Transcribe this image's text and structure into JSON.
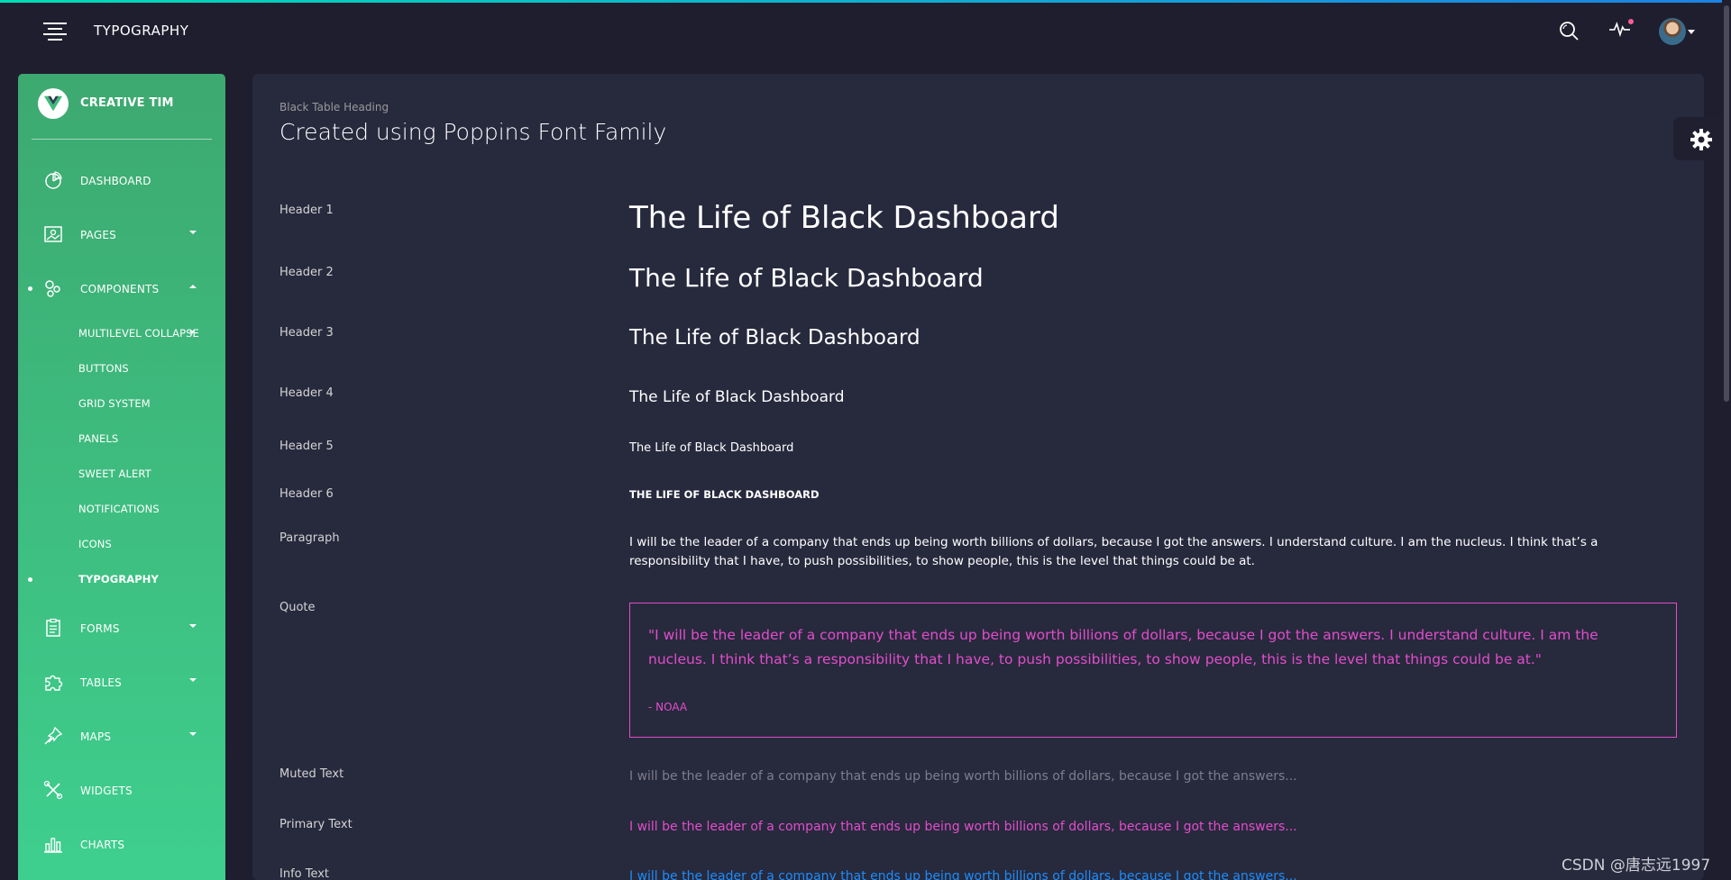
{
  "navbar": {
    "title": "TYPOGRAPHY",
    "icons": [
      "menu-icon",
      "search-icon",
      "activity-icon",
      "avatar"
    ]
  },
  "sidebar": {
    "brand": "CREATIVE TIM",
    "items": [
      {
        "label": "DASHBOARD",
        "icon": "chart-pie-icon"
      },
      {
        "label": "PAGES",
        "icon": "image-icon"
      },
      {
        "label": "COMPONENTS",
        "icon": "molecule-icon"
      },
      {
        "label": "FORMS",
        "icon": "clipboard-icon"
      },
      {
        "label": "TABLES",
        "icon": "puzzle-icon"
      },
      {
        "label": "MAPS",
        "icon": "pin-icon"
      },
      {
        "label": "WIDGETS",
        "icon": "tools-icon"
      },
      {
        "label": "CHARTS",
        "icon": "bar-chart-icon"
      }
    ],
    "subitems": [
      {
        "label": "MULTILEVEL COLLAPSE"
      },
      {
        "label": "BUTTONS"
      },
      {
        "label": "GRID SYSTEM"
      },
      {
        "label": "PANELS"
      },
      {
        "label": "SWEET ALERT"
      },
      {
        "label": "NOTIFICATIONS"
      },
      {
        "label": "ICONS"
      },
      {
        "label": "TYPOGRAPHY"
      }
    ]
  },
  "card": {
    "category": "Black Table Heading",
    "title": "Created using Poppins Font Family",
    "rows": [
      {
        "label": "Header 1",
        "text": "The Life of Black Dashboard"
      },
      {
        "label": "Header 2",
        "text": "The Life of Black Dashboard"
      },
      {
        "label": "Header 3",
        "text": "The Life of Black Dashboard"
      },
      {
        "label": "Header 4",
        "text": "The Life of Black Dashboard"
      },
      {
        "label": "Header 5",
        "text": "The Life of Black Dashboard"
      },
      {
        "label": "Header 6",
        "text": "THE LIFE OF BLACK DASHBOARD"
      },
      {
        "label": "Paragraph",
        "text": "I will be the leader of a company that ends up being worth billions of dollars, because I got the answers. I understand culture. I am the nucleus. I think that’s a responsibility that I have, to push possibilities, to show people, this is the level that things could be at."
      },
      {
        "label": "Quote",
        "text": "\"I will be the leader of a company that ends up being worth billions of dollars, because I got the answers. I understand culture. I am the nucleus. I think that’s a responsibility that I have, to push possibilities, to show people, this is the level that things could be at.\"",
        "footer": "- NOAA"
      },
      {
        "label": "Muted Text",
        "text": "I will be the leader of a company that ends up being worth billions of dollars, because I got the answers..."
      },
      {
        "label": "Primary Text",
        "text": "I will be the leader of a company that ends up being worth billions of dollars, because I got the answers..."
      },
      {
        "label": "Info Text",
        "text": "I will be the leader of a company that ends up being worth billions of dollars, because I got the answers..."
      }
    ]
  },
  "watermark": "CSDN @唐志远1997",
  "colors": {
    "sidebar": "#3ecf8e",
    "background": "#1e1e2f",
    "card": "#27293d",
    "primary": "#e14eca",
    "info": "#1d8cf8",
    "muted": "#7d7d8c"
  }
}
